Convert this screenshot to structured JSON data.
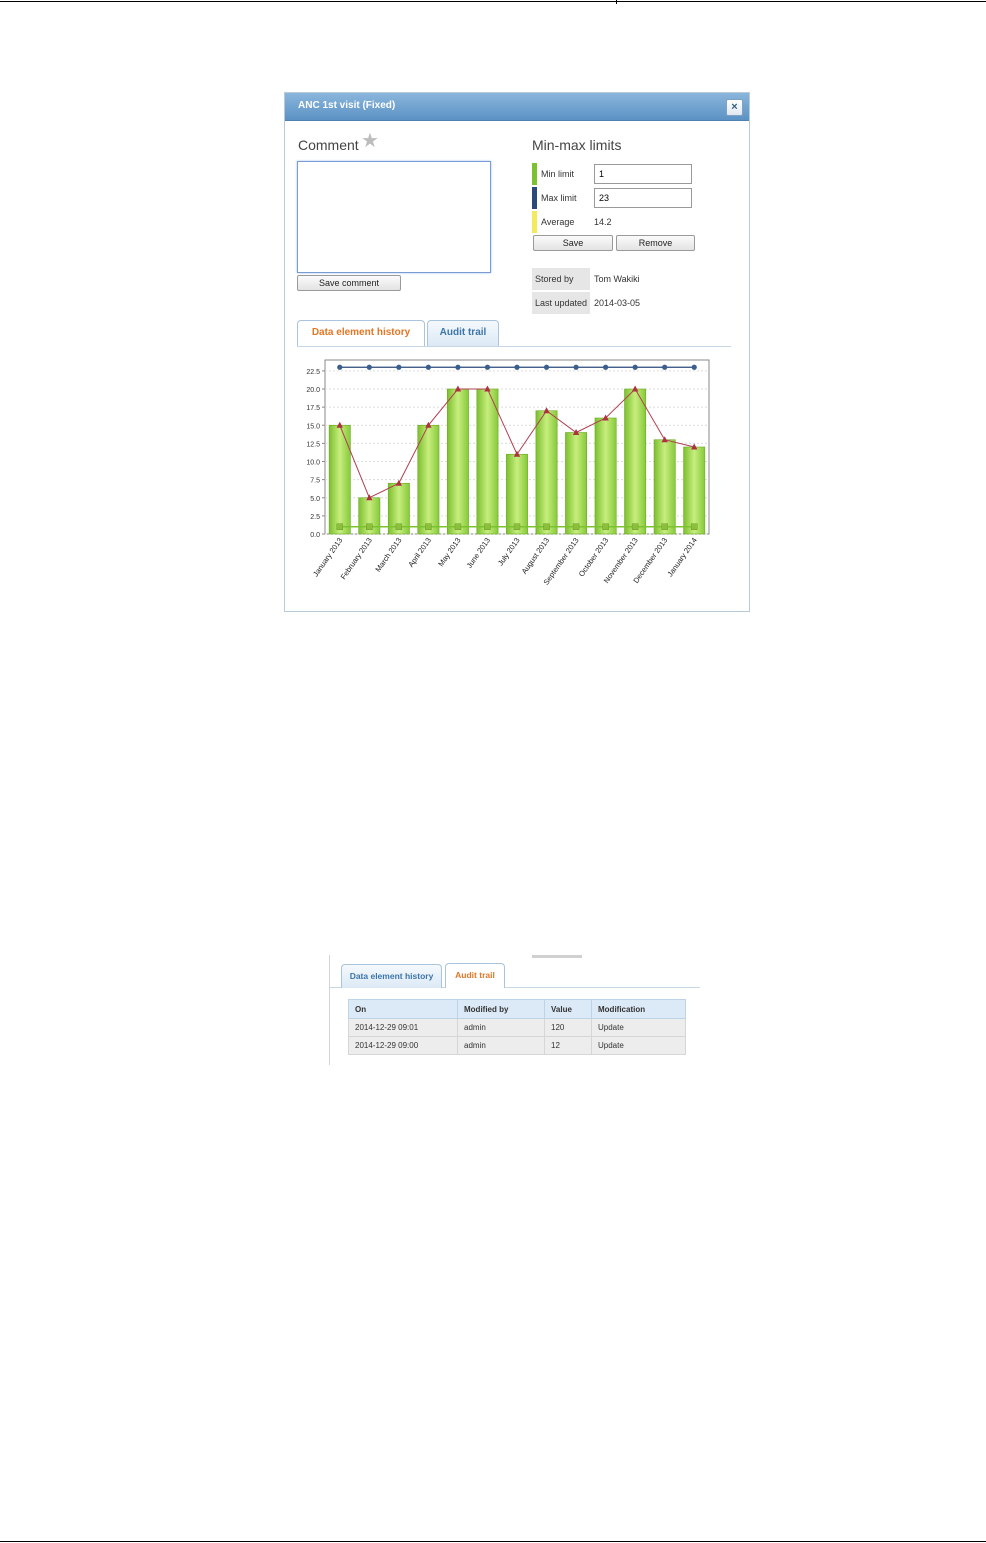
{
  "dialog": {
    "title": "ANC 1st visit (Fixed)",
    "close_symbol": "×",
    "comment_heading": "Comment",
    "comment_value": "",
    "save_comment_label": "Save comment",
    "limits_heading": "Min-max limits",
    "min_label": "Min limit",
    "min_value": "1",
    "max_label": "Max limit",
    "max_value": "23",
    "average_label": "Average",
    "average_value": "14.2",
    "save_label": "Save",
    "remove_label": "Remove",
    "stored_by_label": "Stored by",
    "stored_by_value": "Tom Wakiki",
    "last_updated_label": "Last updated",
    "last_updated_value": "2014-03-05",
    "tabs": [
      {
        "label": "Data element history",
        "active": true
      },
      {
        "label": "Audit trail",
        "active": false
      }
    ]
  },
  "colors": {
    "min": "#7cc230",
    "max": "#2b4a7c",
    "average": "#f3ea5d",
    "bar": "#9ed64a",
    "line": "#b04050",
    "accent": "#e27625"
  },
  "chart_data": {
    "type": "bar",
    "categories": [
      "January 2013",
      "February 2013",
      "March 2013",
      "April 2013",
      "May 2013",
      "June 2013",
      "July 2013",
      "August 2013",
      "September 2013",
      "October 2013",
      "November 2013",
      "December 2013",
      "January 2014"
    ],
    "series": [
      {
        "type": "bar",
        "values": [
          15,
          5,
          7,
          15,
          20,
          20,
          11,
          17,
          14,
          16,
          20,
          13,
          12
        ]
      },
      {
        "type": "line",
        "values": [
          15,
          5,
          7,
          15,
          20,
          20,
          11,
          17,
          14,
          16,
          20,
          13,
          12
        ]
      },
      {
        "type": "line",
        "values": [
          23,
          23,
          23,
          23,
          23,
          23,
          23,
          23,
          23,
          23,
          23,
          23,
          23
        ]
      },
      {
        "type": "line",
        "values": [
          1,
          1,
          1,
          1,
          1,
          1,
          1,
          1,
          1,
          1,
          1,
          1,
          1
        ]
      }
    ],
    "yticks": [
      "0.0",
      "2.5",
      "5.0",
      "7.5",
      "10.0",
      "12.5",
      "15.0",
      "17.5",
      "20.0",
      "22.5"
    ],
    "ylim": [
      0,
      24
    ],
    "grid": true
  },
  "audit": {
    "tabs": [
      {
        "label": "Data element history",
        "active": false
      },
      {
        "label": "Audit trail",
        "active": true
      }
    ],
    "headers": [
      "On",
      "Modified by",
      "Value",
      "Modification"
    ],
    "rows": [
      [
        "2014-12-29 09:01",
        "admin",
        "120",
        "Update"
      ],
      [
        "2014-12-29 09:00",
        "admin",
        "12",
        "Update"
      ]
    ]
  }
}
